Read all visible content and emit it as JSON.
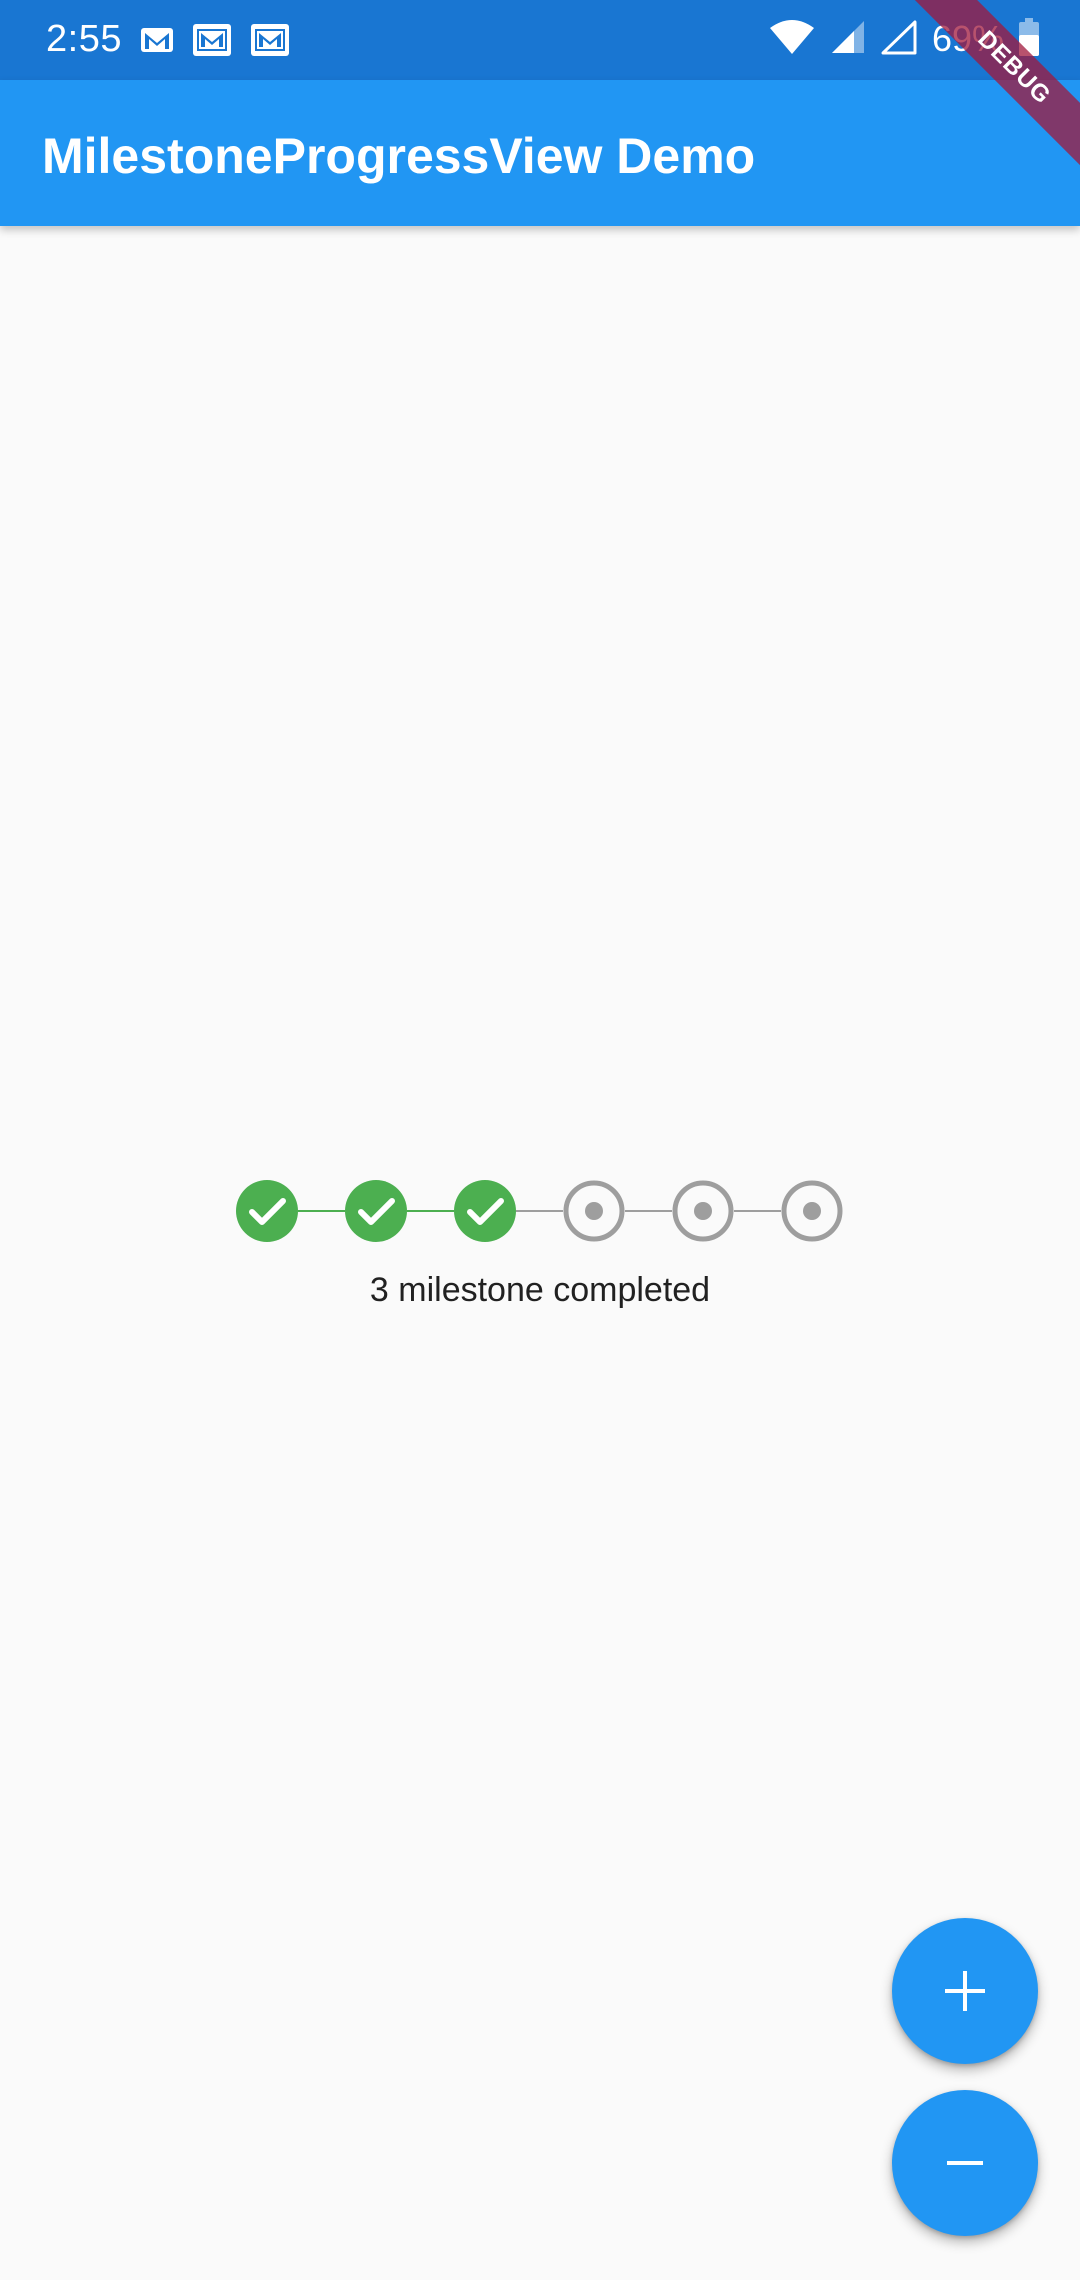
{
  "status_bar": {
    "time": "2:55",
    "battery_percent": "69%",
    "notification_icons": [
      "gmail-icon",
      "gmail-icon",
      "gmail-icon"
    ],
    "system_icons": [
      "wifi-icon",
      "cell-signal-icon",
      "cell-signal-empty-icon",
      "battery-charging-icon"
    ]
  },
  "app_bar": {
    "title": "MilestoneProgressView Demo"
  },
  "debug_banner": {
    "label": "DEBUG"
  },
  "milestone_progress": {
    "total": 6,
    "completed": 3,
    "caption": "3 milestone completed",
    "colors": {
      "completed": "#4caf50",
      "pending": "#9e9e9e"
    }
  },
  "actions": {
    "add_icon": "plus-icon",
    "remove_icon": "minus-icon"
  },
  "colors": {
    "status_bar": "#1976d2",
    "app_bar": "#2196f3",
    "fab": "#2196f3",
    "background": "#fafafa"
  }
}
